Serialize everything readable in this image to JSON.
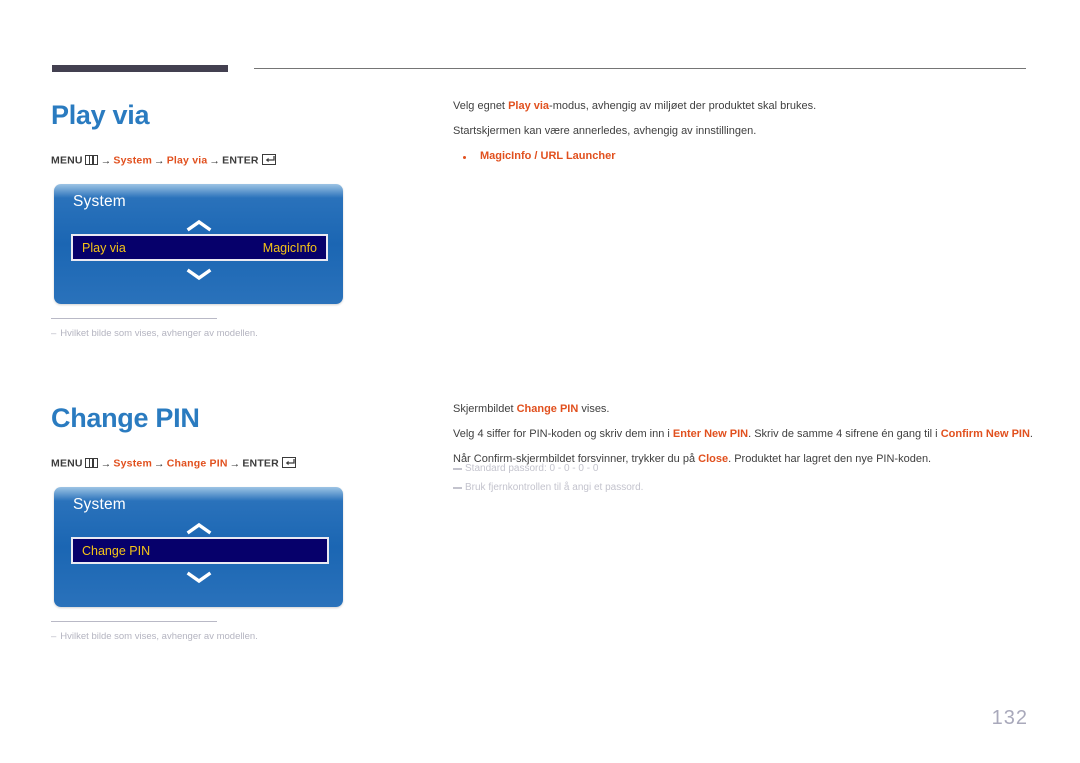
{
  "page": {
    "number": "132"
  },
  "sections": [
    {
      "id": "play-via",
      "heading": "Play via",
      "menupath": {
        "menu_label": "MENU",
        "menu_icon": "menu-grid-icon",
        "arrow": "→",
        "level1": "System",
        "level2": "Play via",
        "enter_label": "ENTER",
        "enter_icon": "enter-return-icon"
      },
      "osd": {
        "title": "System",
        "chevron_up": "chevron-up-icon",
        "chevron_down": "chevron-down-icon",
        "row_label": "Play via",
        "row_value": "MagicInfo"
      },
      "footnote": {
        "dash": "–",
        "text": "Hvilket bilde som vises, avhenger av modellen."
      },
      "body": {
        "line1_pre": "Velg egnet ",
        "line1_accent": "Play via",
        "line1_post": "-modus, avhengig av miljøet der produktet skal brukes.",
        "line2": "Startskjermen kan være annerledes, avhengig av innstillingen.",
        "bullet": "MagicInfo / URL Launcher"
      }
    },
    {
      "id": "change-pin",
      "heading": "Change PIN",
      "menupath": {
        "menu_label": "MENU",
        "menu_icon": "menu-grid-icon",
        "arrow": "→",
        "level1": "System",
        "level2": "Change PIN",
        "enter_label": "ENTER",
        "enter_icon": "enter-return-icon"
      },
      "osd": {
        "title": "System",
        "chevron_up": "chevron-up-icon",
        "chevron_down": "chevron-down-icon",
        "row_label": "Change PIN",
        "row_value": ""
      },
      "footnote": {
        "dash": "–",
        "text": "Hvilket bilde som vises, avhenger av modellen."
      },
      "body": {
        "l1_pre": "Skjermbildet ",
        "l1_accent": "Change PIN",
        "l1_post": " vises.",
        "l2_pre": "Velg 4 siffer for PIN-koden og skriv dem inn i ",
        "l2_accent1": "Enter New PIN",
        "l2_mid": ". Skriv de samme 4 sifrene én gang til i ",
        "l2_accent2": "Confirm New PIN",
        "l2_post": ".",
        "l3_pre": "Når Confirm-skjermbildet forsvinner, trykker du på ",
        "l3_accent": "Close",
        "l3_post": ". Produktet har lagret den nye PIN-koden."
      },
      "notes": [
        "Standard passord: 0 - 0 - 0 - 0",
        "Bruk fjernkontrollen til å angi et passord."
      ]
    }
  ],
  "colors": {
    "heading_blue": "#2a7bc0",
    "accent_orange": "#e1501e",
    "osd_blue": "#1b66b3",
    "osd_row_navy": "#06006b",
    "osd_row_text": "#f5c417",
    "rule_dark": "#434050",
    "muted_gray": "#b4b4c0"
  }
}
